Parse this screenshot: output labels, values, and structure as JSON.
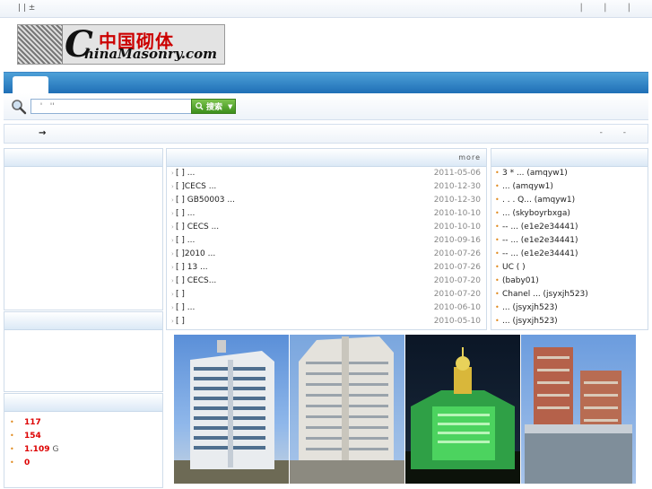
{
  "topbar": {
    "left_text": "|    | ±",
    "right_text": "| | |"
  },
  "logo": {
    "cn": "中国砌体",
    "c": "C",
    "en": "hinaMasonry.com"
  },
  "search": {
    "placeholder": "  '   ''",
    "button_label": "搜索"
  },
  "breadcrumb": {
    "arrow": "→",
    "right": "- -"
  },
  "stats": [
    {
      "value": "117",
      "unit": ""
    },
    {
      "value": "154",
      "unit": ""
    },
    {
      "value": "1.109",
      "unit": "G"
    },
    {
      "value": "0",
      "unit": ""
    }
  ],
  "news": {
    "more_label": "more",
    "items": [
      {
        "title": "[  ]                ...",
        "date": "2011-05-06"
      },
      {
        "title": "[  ]CECS                ...",
        "date": "2010-12-30"
      },
      {
        "title": "[  ]          GB50003    ...",
        "date": "2010-12-30"
      },
      {
        "title": "[  ]                ...",
        "date": "2010-10-10"
      },
      {
        "title": "[  ]             CECS  ...",
        "date": "2010-10-10"
      },
      {
        "title": "[  ]                ...",
        "date": "2010-09-16"
      },
      {
        "title": "[  ]2010                ...",
        "date": "2010-07-26"
      },
      {
        "title": "[  ]        13         ...",
        "date": "2010-07-26"
      },
      {
        "title": "[  ]              CECS...",
        "date": "2010-07-20"
      },
      {
        "title": "[  ]",
        "date": "2010-07-20"
      },
      {
        "title": "[  ]                ...",
        "date": "2010-06-10"
      },
      {
        "title": "[  ]",
        "date": "2010-05-10"
      }
    ]
  },
  "users": [
    "3    *    ...  (amqyw1)",
    "           ...  (amqyw1)",
    ". . . Q...  (amqyw1)",
    "           ...  (skyboyrbxga)",
    "      --    ...  (e1e2e34441)",
    "      --    ...  (e1e2e34441)",
    "      --    ...  (e1e2e34441)",
    "UC          (       )",
    "     (baby01)",
    "Chanel    ...  (jsyxjh523)",
    "           ...  (jsyxjh523)",
    "           ...  (jsyxjh523)"
  ],
  "colors": {
    "nav": "#1f6fb6",
    "accent": "#d00000",
    "bullet": "#e08a1e",
    "search_btn": "#3d8f1c"
  }
}
